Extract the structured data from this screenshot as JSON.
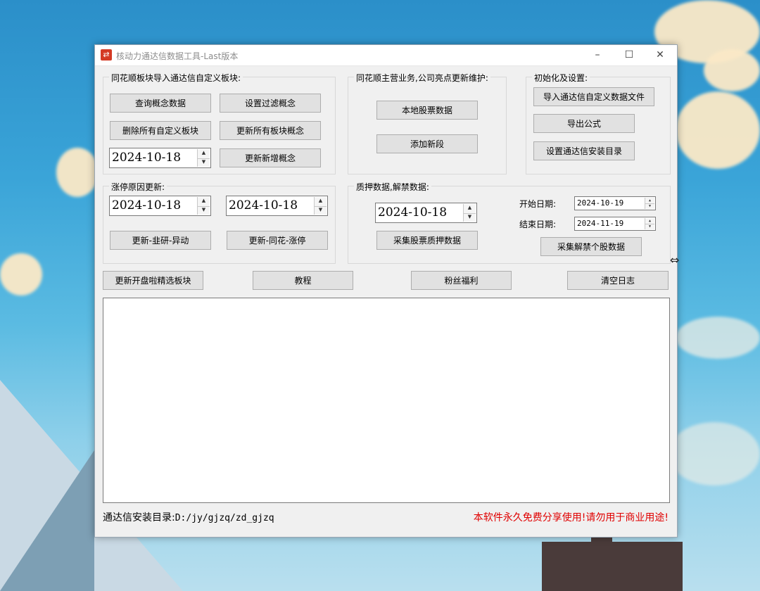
{
  "window": {
    "title": "核动力通达信数据工具-Last版本",
    "minimize": "–",
    "maximize": "☐",
    "close": "✕"
  },
  "group_concept": {
    "title": "同花顺板块导入通达信自定义板块:",
    "btn_query": "查询概念数据",
    "btn_filter": "设置过滤概念",
    "btn_delete_all": "删除所有自定义板块",
    "btn_update_all": "更新所有板块概念",
    "date": "2024-10-18",
    "btn_update_new": "更新新增概念"
  },
  "group_business": {
    "title": "同花顺主营业务,公司亮点更新维护:",
    "btn_local_stock": "本地股票数据",
    "btn_add_field": "添加新段"
  },
  "group_init": {
    "title": "初始化及设置:",
    "btn_import": "导入通达信自定义数据文件",
    "btn_export": "导出公式",
    "btn_set_dir": "设置通达信安装目录"
  },
  "group_limitup": {
    "title": "涨停原因更新:",
    "date1": "2024-10-18",
    "date2": "2024-10-18",
    "btn_update_jy": "更新-韭研-异动",
    "btn_update_ths": "更新-同花-涨停"
  },
  "group_pledge": {
    "title": "质押数据,解禁数据:",
    "date": "2024-10-18",
    "btn_collect_pledge": "采集股票质押数据",
    "start_label": "开始日期:",
    "start_date": "2024-10-19",
    "end_label": "结束日期:",
    "end_date": "2024-11-19",
    "btn_collect_unlock": "采集解禁个股数据"
  },
  "bottom_buttons": {
    "update_kpl": "更新开盘啦精选板块",
    "tutorial": "教程",
    "fans": "粉丝福利",
    "clear_log": "清空日志"
  },
  "footer": {
    "dir_label": "通达信安装目录:",
    "dir_value": "D:/jy/gjzq/zd_gjzq",
    "notice": "本软件永久免费分享使用!请勿用于商业用途!"
  },
  "spin": {
    "up": "▲",
    "down": "▼"
  },
  "colors": {
    "notice_red": "#e00000",
    "app_icon_red": "#d43a24"
  }
}
